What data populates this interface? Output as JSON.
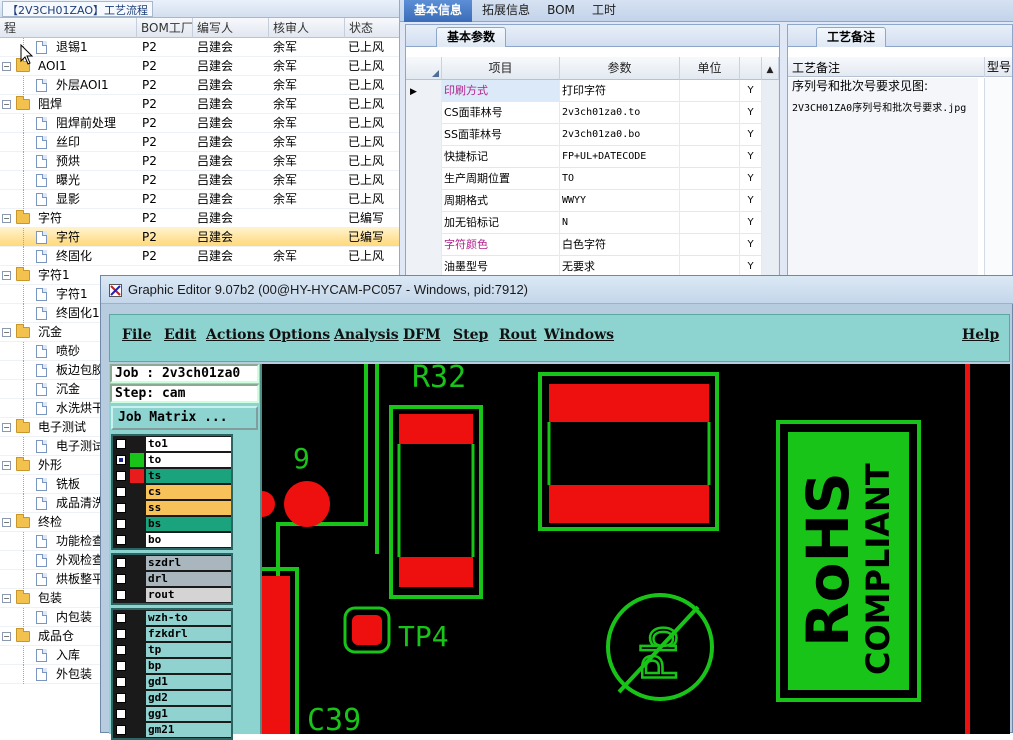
{
  "left_panel": {
    "doc_tab_label": "【2V3CH01ZAO】工艺流程",
    "columns": [
      "程",
      "BOM工厂",
      "编写人",
      "核审人",
      "状态"
    ],
    "rows": [
      {
        "name": "退锡1",
        "type": "doc",
        "level": 1,
        "bom": "P2",
        "writer": "吕建会",
        "reviewer": "余军",
        "status": "已上风"
      },
      {
        "name": "AOI1",
        "type": "folder",
        "level": 0,
        "bom": "P2",
        "writer": "吕建会",
        "reviewer": "余军",
        "status": "已上风"
      },
      {
        "name": "外层AOI1",
        "type": "doc",
        "level": 1,
        "bom": "P2",
        "writer": "吕建会",
        "reviewer": "余军",
        "status": "已上风"
      },
      {
        "name": "阻焊",
        "type": "folder",
        "level": 0,
        "bom": "P2",
        "writer": "吕建会",
        "reviewer": "余军",
        "status": "已上风"
      },
      {
        "name": "阻焊前处理",
        "type": "doc",
        "level": 1,
        "bom": "P2",
        "writer": "吕建会",
        "reviewer": "余军",
        "status": "已上风"
      },
      {
        "name": "丝印",
        "type": "doc",
        "level": 1,
        "bom": "P2",
        "writer": "吕建会",
        "reviewer": "余军",
        "status": "已上风"
      },
      {
        "name": "预烘",
        "type": "doc",
        "level": 1,
        "bom": "P2",
        "writer": "吕建会",
        "reviewer": "余军",
        "status": "已上风"
      },
      {
        "name": "曝光",
        "type": "doc",
        "level": 1,
        "bom": "P2",
        "writer": "吕建会",
        "reviewer": "余军",
        "status": "已上风"
      },
      {
        "name": "显影",
        "type": "doc",
        "level": 1,
        "bom": "P2",
        "writer": "吕建会",
        "reviewer": "余军",
        "status": "已上风"
      },
      {
        "name": "字符",
        "type": "folder",
        "level": 0,
        "bom": "P2",
        "writer": "吕建会",
        "reviewer": "",
        "status": "已编写"
      },
      {
        "name": "字符",
        "type": "doc",
        "level": 1,
        "bom": "P2",
        "writer": "吕建会",
        "reviewer": "",
        "status": "已编写",
        "selected": true
      },
      {
        "name": "终固化",
        "type": "doc",
        "level": 1,
        "bom": "P2",
        "writer": "吕建会",
        "reviewer": "余军",
        "status": "已上风"
      },
      {
        "name": "字符1",
        "type": "folder",
        "level": 0,
        "bom": "",
        "writer": "",
        "reviewer": "",
        "status": ""
      },
      {
        "name": "字符1",
        "type": "doc",
        "level": 1,
        "bom": "",
        "writer": "",
        "reviewer": "",
        "status": ""
      },
      {
        "name": "终固化1",
        "type": "doc",
        "level": 1,
        "bom": "",
        "writer": "",
        "reviewer": "",
        "status": ""
      },
      {
        "name": "沉金",
        "type": "folder",
        "level": 0,
        "bom": "",
        "writer": "",
        "reviewer": "",
        "status": ""
      },
      {
        "name": "喷砂",
        "type": "doc",
        "level": 1,
        "bom": "",
        "writer": "",
        "reviewer": "",
        "status": ""
      },
      {
        "name": "板边包胶",
        "type": "doc",
        "level": 1,
        "bom": "",
        "writer": "",
        "reviewer": "",
        "status": ""
      },
      {
        "name": "沉金",
        "type": "doc",
        "level": 1,
        "bom": "",
        "writer": "",
        "reviewer": "",
        "status": ""
      },
      {
        "name": "水洗烘干",
        "type": "doc",
        "level": 1,
        "bom": "",
        "writer": "",
        "reviewer": "",
        "status": ""
      },
      {
        "name": "电子测试",
        "type": "folder",
        "level": 0,
        "bom": "",
        "writer": "",
        "reviewer": "",
        "status": ""
      },
      {
        "name": "电子测试",
        "type": "doc",
        "level": 1,
        "bom": "",
        "writer": "",
        "reviewer": "",
        "status": ""
      },
      {
        "name": "外形",
        "type": "folder",
        "level": 0,
        "bom": "",
        "writer": "",
        "reviewer": "",
        "status": ""
      },
      {
        "name": "铣板",
        "type": "doc",
        "level": 1,
        "bom": "",
        "writer": "",
        "reviewer": "",
        "status": ""
      },
      {
        "name": "成品清洗",
        "type": "doc",
        "level": 1,
        "bom": "",
        "writer": "",
        "reviewer": "",
        "status": ""
      },
      {
        "name": "终检",
        "type": "folder",
        "level": 0,
        "bom": "",
        "writer": "",
        "reviewer": "",
        "status": ""
      },
      {
        "name": "功能检查",
        "type": "doc",
        "level": 1,
        "bom": "",
        "writer": "",
        "reviewer": "",
        "status": ""
      },
      {
        "name": "外观检查",
        "type": "doc",
        "level": 1,
        "bom": "",
        "writer": "",
        "reviewer": "",
        "status": ""
      },
      {
        "name": "烘板整平",
        "type": "doc",
        "level": 1,
        "bom": "",
        "writer": "",
        "reviewer": "",
        "status": ""
      },
      {
        "name": "包装",
        "type": "folder",
        "level": 0,
        "bom": "",
        "writer": "",
        "reviewer": "",
        "status": ""
      },
      {
        "name": "内包装",
        "type": "doc",
        "level": 1,
        "bom": "",
        "writer": "",
        "reviewer": "",
        "status": ""
      },
      {
        "name": "成品仓",
        "type": "folder",
        "level": 0,
        "bom": "",
        "writer": "",
        "reviewer": "",
        "status": ""
      },
      {
        "name": "入库",
        "type": "doc",
        "level": 1,
        "bom": "",
        "writer": "",
        "reviewer": "",
        "status": ""
      },
      {
        "name": "外包装",
        "type": "doc",
        "level": 1,
        "bom": "",
        "writer": "",
        "reviewer": "",
        "status": ""
      }
    ]
  },
  "right_panel": {
    "main_tabs": [
      "基本信息",
      "拓展信息",
      "BOM",
      "工时"
    ],
    "params_tab": "基本参数",
    "params_columns": [
      "项目",
      "参数",
      "单位",
      ""
    ],
    "params_rows": [
      {
        "item": "印刷方式",
        "value": "打印字符",
        "unit": "",
        "flag": "Y",
        "highlight": true,
        "selected": true
      },
      {
        "item": "CS面菲林号",
        "value": "2v3ch01za0.to",
        "unit": "",
        "flag": "Y"
      },
      {
        "item": "SS面菲林号",
        "value": "2v3ch01za0.bo",
        "unit": "",
        "flag": "Y"
      },
      {
        "item": "快捷标记",
        "value": "FP+UL+DATECODE",
        "unit": "",
        "flag": "Y"
      },
      {
        "item": "生产周期位置",
        "value": "TO",
        "unit": "",
        "flag": "Y"
      },
      {
        "item": "周期格式",
        "value": "WWYY",
        "unit": "",
        "flag": "Y"
      },
      {
        "item": "加无铅标记",
        "value": "N",
        "unit": "",
        "flag": "Y"
      },
      {
        "item": "字符颜色",
        "value": "白色字符",
        "unit": "",
        "flag": "Y",
        "highlight": true
      },
      {
        "item": "油墨型号",
        "value": "无要求",
        "unit": "",
        "flag": "Y"
      }
    ],
    "remark_tab": "工艺备注",
    "remark_col1": "工艺备注",
    "remark_col2": "型号",
    "remark_lines": [
      "序列号和批次号要求见图:",
      "",
      "2V3CH01ZA0序列号和批次号要求.jpg"
    ]
  },
  "graphic_editor": {
    "title": "Graphic Editor 9.07b2 (00@HY-HYCAM-PC057 - Windows, pid:7912)",
    "menus": [
      "File",
      "Edit",
      "Actions",
      "Options",
      "Analysis",
      "DFM",
      "Step",
      "Rout",
      "Windows"
    ],
    "help_menu": "Help",
    "job_label": "Job : 2v3ch01za0",
    "step_label": "Step: cam",
    "job_matrix_button": "Job Matrix ...",
    "layer_groups": [
      [
        {
          "name": "to1",
          "swatch": "#1a1a1a",
          "bg": "#ffffff",
          "checked": false
        },
        {
          "name": "to",
          "swatch": "#19c419",
          "bg": "#ffffff",
          "checked": true
        },
        {
          "name": "ts",
          "swatch": "#e81c1c",
          "bg": "#1ba37e",
          "checked": false
        },
        {
          "name": "cs",
          "swatch": "#1a1a1a",
          "bg": "#f7c25a",
          "checked": false
        },
        {
          "name": "ss",
          "swatch": "#1a1a1a",
          "bg": "#f7c25a",
          "checked": false
        },
        {
          "name": "bs",
          "swatch": "#1a1a1a",
          "bg": "#1ba37e",
          "checked": false
        },
        {
          "name": "bo",
          "swatch": "#1a1a1a",
          "bg": "#ffffff",
          "checked": false
        }
      ],
      [
        {
          "name": "szdrl",
          "swatch": "#1a1a1a",
          "bg": "#a9b6bd",
          "checked": false
        },
        {
          "name": "drl",
          "swatch": "#1a1a1a",
          "bg": "#a9b6bd",
          "checked": false
        },
        {
          "name": "rout",
          "swatch": "#1a1a1a",
          "bg": "#d4d4d4",
          "checked": false
        }
      ],
      [
        {
          "name": "wzh-to",
          "swatch": "#1a1a1a",
          "bg": "#8fd2d0",
          "checked": false
        },
        {
          "name": "fzkdrl",
          "swatch": "#1a1a1a",
          "bg": "#8fd2d0",
          "checked": false
        },
        {
          "name": "tp",
          "swatch": "#1a1a1a",
          "bg": "#8fd2d0",
          "checked": false
        },
        {
          "name": "bp",
          "swatch": "#1a1a1a",
          "bg": "#8fd2d0",
          "checked": false
        },
        {
          "name": "gd1",
          "swatch": "#1a1a1a",
          "bg": "#8fd2d0",
          "checked": false
        },
        {
          "name": "gd2",
          "swatch": "#1a1a1a",
          "bg": "#8fd2d0",
          "checked": false
        },
        {
          "name": "gg1",
          "swatch": "#1a1a1a",
          "bg": "#8fd2d0",
          "checked": false
        },
        {
          "name": "gm21",
          "swatch": "#1a1a1a",
          "bg": "#8fd2d0",
          "checked": false
        }
      ]
    ],
    "canvas_labels": {
      "r32": "R32",
      "nine": "9",
      "tp4": "TP4",
      "c39": "C39",
      "rohs": "RoHS",
      "compliant": "COMPLIANT",
      "pb": "Pb"
    },
    "colors": {
      "silk": "#19c419",
      "pad": "#ee0f0f",
      "board": "#000000"
    }
  }
}
